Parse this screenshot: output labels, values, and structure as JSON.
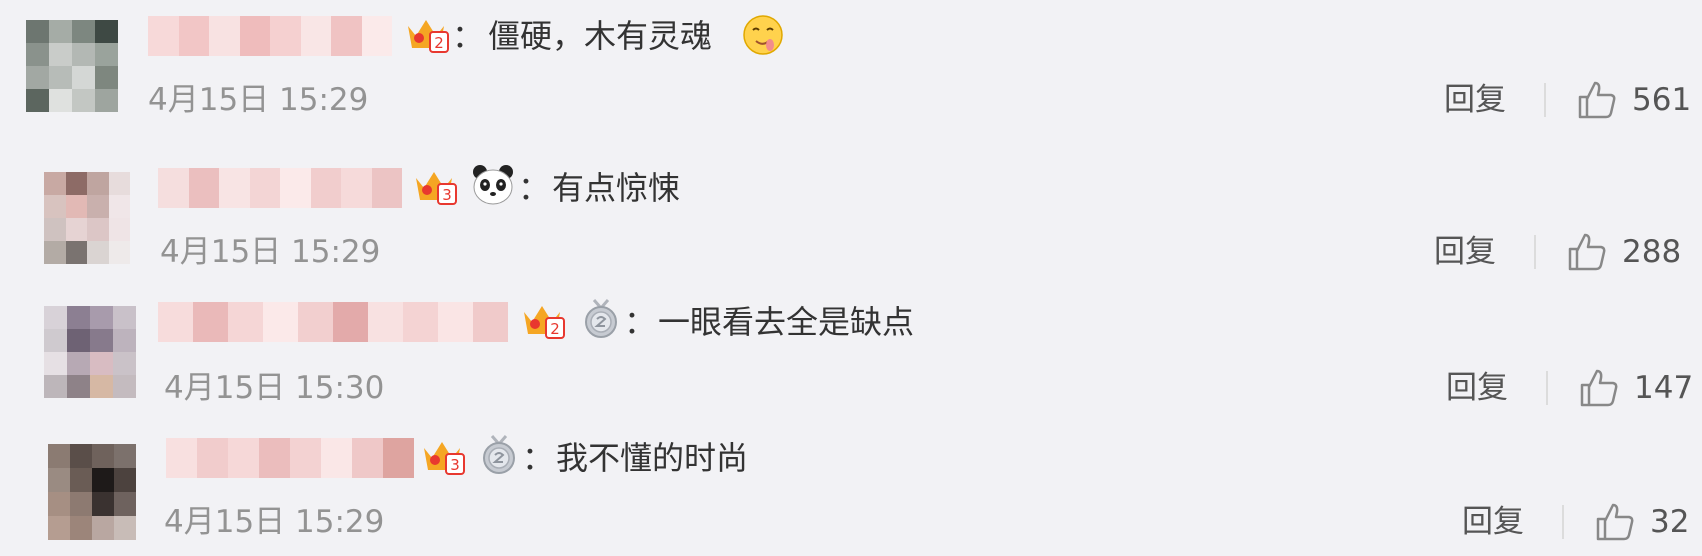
{
  "comments": [
    {
      "text": "僵硬，木有灵魂",
      "time": "4月15日 15:29",
      "reply_label": "回复",
      "likes": "561",
      "level_badge": "2",
      "emoji": "drooling-face"
    },
    {
      "text": "有点惊悚",
      "time": "4月15日 15:29",
      "reply_label": "回复",
      "likes": "288",
      "level_badge": "3",
      "emoji": "panda-face"
    },
    {
      "text": "一眼看去全是缺点",
      "time": "4月15日 15:30",
      "reply_label": "回复",
      "likes": "147",
      "level_badge": "2",
      "emoji": "silver-medal"
    },
    {
      "text": "我不懂的时尚",
      "time": "4月15日 15:29",
      "reply_label": "回复",
      "likes": "32",
      "level_badge": "3",
      "emoji": "silver-medal"
    }
  ],
  "colon": "：",
  "colors": {
    "background": "#f2f2f5",
    "time": "#939393",
    "badge_orange": "#f5a623",
    "badge_red": "#e8382f"
  }
}
